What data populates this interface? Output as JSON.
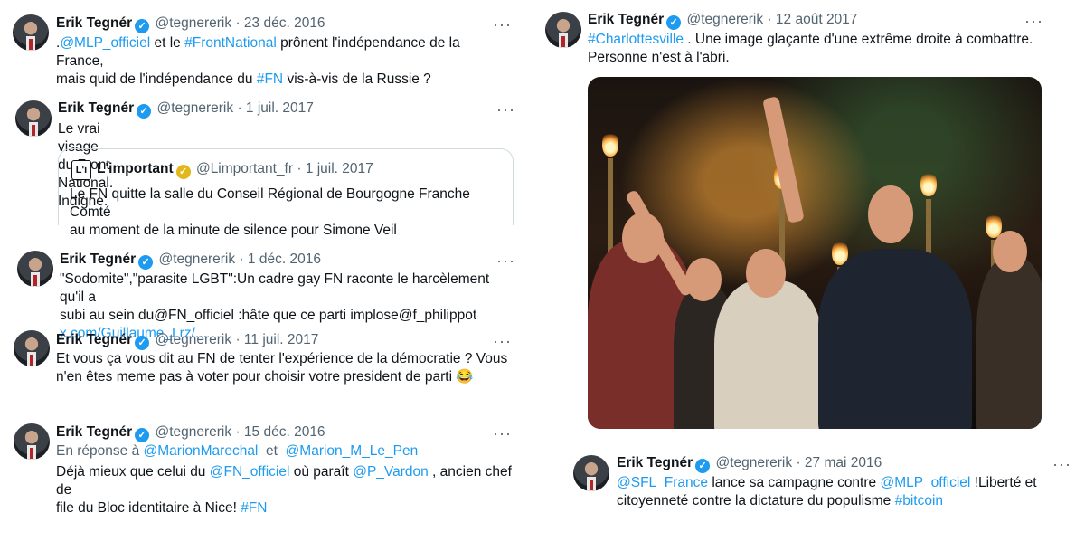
{
  "accent_color": "#1d9bf0",
  "tweets": [
    {
      "name": "Erik Tegnér",
      "handle": "@tegnererik",
      "dot": "·",
      "date": "23 déc. 2016",
      "more": "···",
      "l1": [
        ".",
        "@MLP_officiel",
        " et le ",
        "#FrontNational",
        " prônent l'indépendance de la France,"
      ],
      "l2": [
        "mais quid de l'indépendance du ",
        "#FN",
        " vis-à-vis de la Russie ?"
      ]
    },
    {
      "name": "Erik Tegnér",
      "handle": "@tegnererik",
      "dot": "·",
      "date": "1 juil. 2017",
      "more": "···",
      "l1": "Le vrai visage du Front National. Indigne.",
      "quote": {
        "logo": "L'i",
        "name": "L'important",
        "handle": "@Limportant_fr",
        "dot": "·",
        "date": "1 juil. 2017",
        "l1": "Le FN quitte la salle du Conseil Régional de Bourgogne Franche Comté",
        "l2": "au moment de la minute de silence pour Simone Veil"
      }
    },
    {
      "name": "Erik Tegnér",
      "handle": "@tegnererik",
      "dot": "·",
      "date": "1 déc. 2016",
      "more": "···",
      "l1": "\"Sodomite\",\"parasite LGBT\":Un cadre gay FN raconte le harcèlement qu'il a",
      "l2": "subi au sein du@FN_officiel :hâte que ce parti implose@f_philippot",
      "l3": "x.com/Guillaume_Lrz/..."
    },
    {
      "name": "Erik Tegnér",
      "handle": "@tegnererik",
      "dot": "·",
      "date": "11 juil. 2017",
      "more": "···",
      "l1": "Et vous ça vous dit au FN de tenter l'expérience de la démocratie ? Vous",
      "l2": "n'en êtes meme pas à voter pour choisir votre president de parti 😂"
    },
    {
      "name": "Erik Tegnér",
      "handle": "@tegnererik",
      "dot": "·",
      "date": "15 déc. 2016",
      "more": "···",
      "reply": [
        "En réponse à ",
        "@MarionMarechal",
        "  et  ",
        "@Marion_M_Le_Pen"
      ],
      "l1": [
        "Déjà mieux que celui du ",
        "@FN_officiel",
        " où paraît ",
        "@P_Vardon",
        " , ancien chef de"
      ],
      "l2": [
        "file du Bloc identitaire à Nice! ",
        "#FN"
      ]
    },
    {
      "name": "Erik Tegnér",
      "handle": "@tegnererik",
      "dot": "·",
      "date": "12 août 2017",
      "more": "···",
      "l1": [
        "#Charlottesville",
        " . Une image glaçante d'une extrême droite à combattre."
      ],
      "l2": "Personne n'est à l'abri."
    },
    {
      "name": "Erik Tegnér",
      "handle": "@tegnererik",
      "dot": "·",
      "date": "27 mai 2016",
      "more": "···",
      "l1": [
        "@SFL_France",
        " lance sa campagne contre ",
        "@MLP_officiel",
        " !Liberté et"
      ],
      "l2": [
        "citoyenneté contre la dictature du populisme ",
        "#bitcoin"
      ]
    }
  ]
}
